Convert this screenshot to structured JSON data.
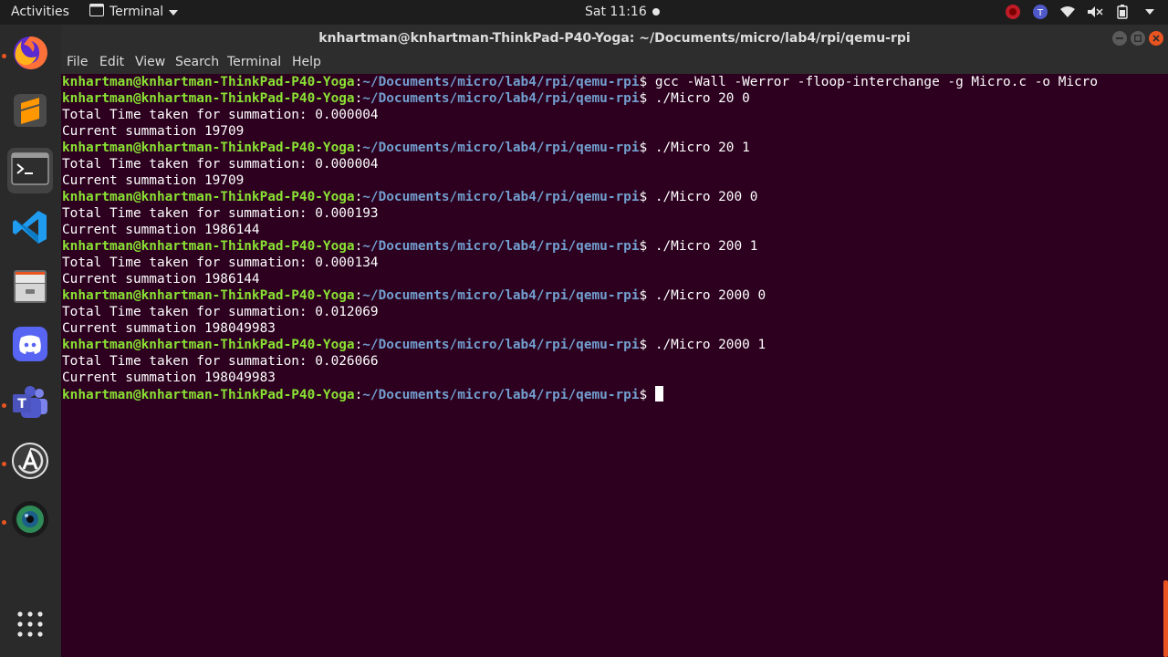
{
  "topbar": {
    "activities": "Activities",
    "app_menu": "Terminal",
    "clock": "Sat 11:16"
  },
  "dock": {
    "items": [
      {
        "name": "firefox-icon"
      },
      {
        "name": "sublime-text-icon"
      },
      {
        "name": "terminal-icon"
      },
      {
        "name": "vscode-icon"
      },
      {
        "name": "files-icon"
      },
      {
        "name": "discord-icon"
      },
      {
        "name": "teams-icon"
      },
      {
        "name": "software-updater-icon"
      },
      {
        "name": "webcam-icon"
      },
      {
        "name": "show-apps-icon"
      }
    ]
  },
  "window": {
    "title": "knhartman@knhartman-ThinkPad-P40-Yoga: ~/Documents/micro/lab4/rpi/qemu-rpi"
  },
  "menu": {
    "file": "File",
    "edit": "Edit",
    "view": "View",
    "search": "Search",
    "terminal": "Terminal",
    "help": "Help"
  },
  "terminal": {
    "user_host": "knhartman@knhartman-ThinkPad-P40-Yoga",
    "path": "~/Documents/micro/lab4/rpi/qemu-rpi",
    "lines": [
      {
        "cmd": " gcc -Wall -Werror -floop-interchange -g Micro.c -o Micro"
      },
      {
        "cmd": " ./Micro 20 0"
      },
      {
        "out": "Total Time taken for summation: 0.000004"
      },
      {
        "out": "Current summation 19709"
      },
      {
        "cmd": " ./Micro 20 1"
      },
      {
        "out": "Total Time taken for summation: 0.000004"
      },
      {
        "out": "Current summation 19709"
      },
      {
        "cmd": " ./Micro 200 0"
      },
      {
        "out": "Total Time taken for summation: 0.000193"
      },
      {
        "out": "Current summation 1986144"
      },
      {
        "cmd": " ./Micro 200 1"
      },
      {
        "out": "Total Time taken for summation: 0.000134"
      },
      {
        "out": "Current summation 1986144"
      },
      {
        "cmd": " ./Micro 2000 0"
      },
      {
        "out": "Total Time taken for summation: 0.012069"
      },
      {
        "out": "Current summation 198049983"
      },
      {
        "cmd": " ./Micro 2000 1"
      },
      {
        "out": "Total Time taken for summation: 0.026066"
      },
      {
        "out": "Current summation 198049983"
      },
      {
        "cmd": " ",
        "cursor": true
      }
    ]
  },
  "colors": {
    "terminal_bg": "#2c001e",
    "prompt_user": "#8ae234",
    "prompt_path": "#729fcf",
    "accent": "#e95420"
  }
}
